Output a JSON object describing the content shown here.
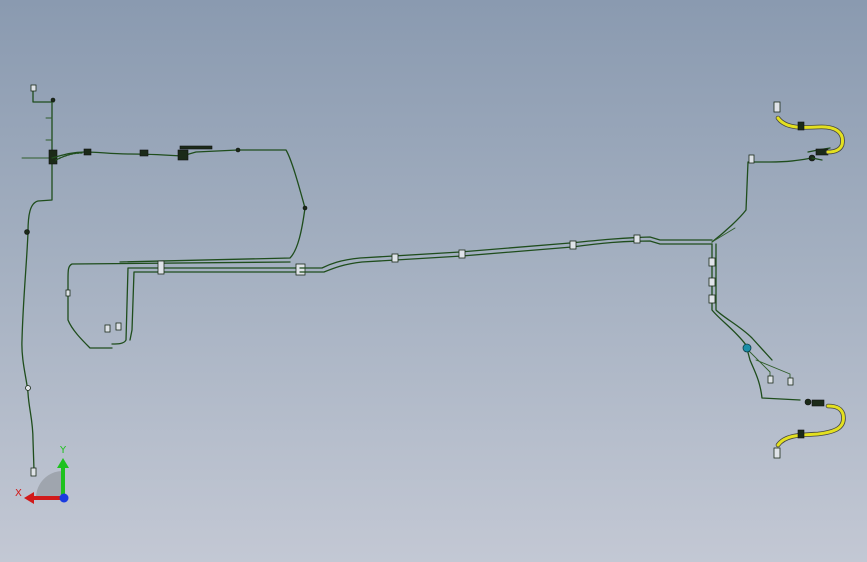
{
  "triad": {
    "x_label": "X",
    "y_label": "Y",
    "x_color": "#d11a1a",
    "y_color": "#1ec21e",
    "z_color": "#1a3be0"
  },
  "viewport": {
    "background_top": "#8a9ab0",
    "background_bottom": "#c3c8d4",
    "pipe_color": "#1f4d1c",
    "hose_color": "#e3e020"
  }
}
